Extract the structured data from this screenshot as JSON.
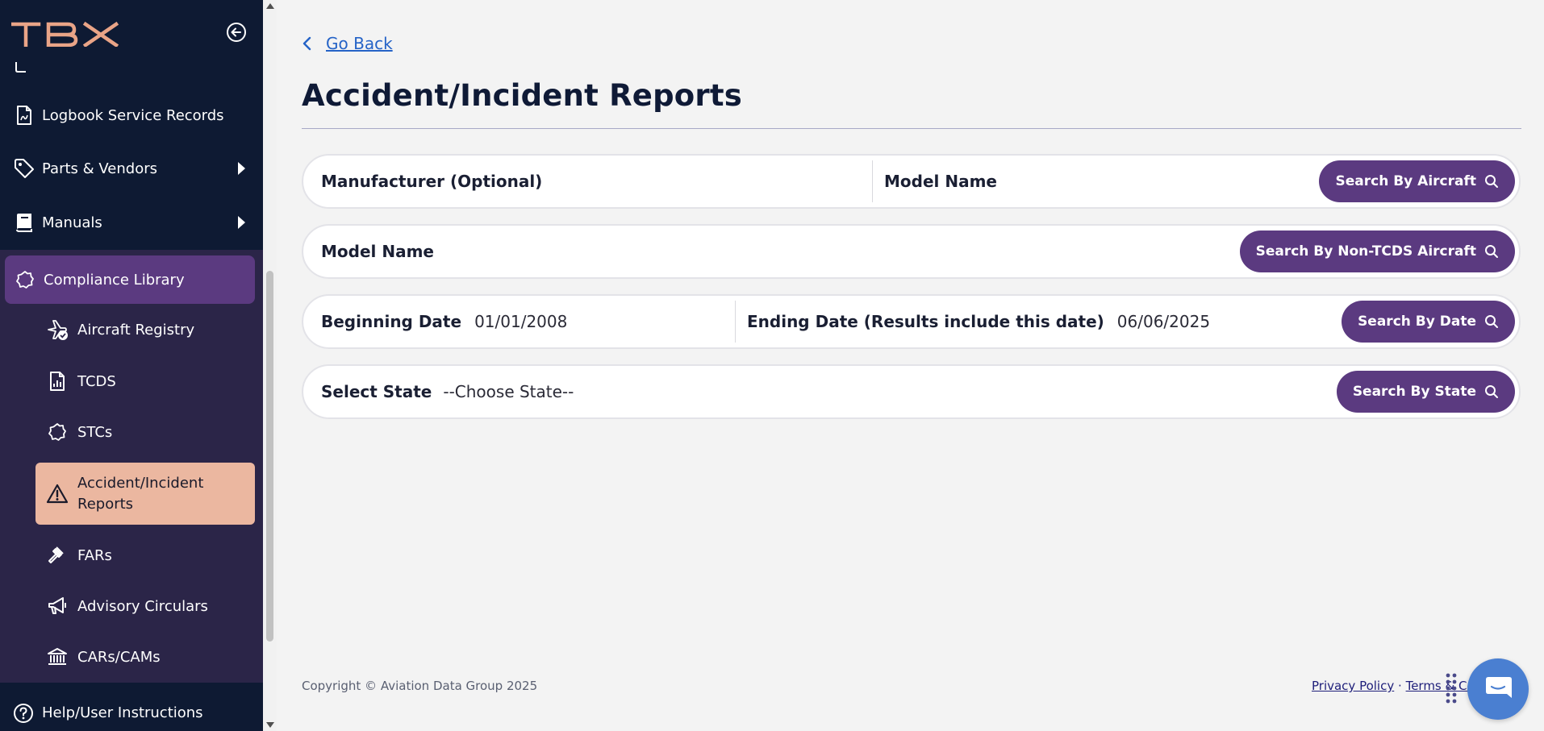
{
  "app": {
    "logo_text": "TBX",
    "collapse_icon": "arrow-left-circle-icon"
  },
  "sidebar": {
    "items": [
      {
        "label": "Logbook Service Records",
        "icon": "document-icon"
      },
      {
        "label": "Parts & Vendors",
        "icon": "tag-icon"
      },
      {
        "label": "Manuals",
        "icon": "book-icon"
      },
      {
        "label": "Compliance Library",
        "icon": "badge-icon",
        "expanded": true
      }
    ],
    "sub_items": [
      {
        "label": "Aircraft Registry",
        "icon": "airplane-check-icon"
      },
      {
        "label": "TCDS",
        "icon": "chart-document-icon"
      },
      {
        "label": "STCs",
        "icon": "badge-icon"
      },
      {
        "label": "Accident/Incident Reports",
        "icon": "warning-icon",
        "active": true
      },
      {
        "label": "FARs",
        "icon": "gavel-icon"
      },
      {
        "label": "Advisory Circulars",
        "icon": "megaphone-icon"
      },
      {
        "label": "CARs/CAMs",
        "icon": "bank-icon"
      }
    ],
    "help": {
      "label": "Help/User Instructions",
      "icon": "question-circle-icon"
    }
  },
  "main": {
    "go_back": "Go Back",
    "title": "Accident/Incident Reports",
    "row1": {
      "manufacturer_label": "Manufacturer (Optional)",
      "model_label": "Model Name",
      "button": "Search By Aircraft"
    },
    "row2": {
      "model_label": "Model Name",
      "button": "Search By Non-TCDS Aircraft"
    },
    "row3": {
      "begin_label": "Beginning Date",
      "begin_value": "01/01/2008",
      "end_label": "Ending Date (Results include this date)",
      "end_value": "06/06/2025",
      "button": "Search By Date"
    },
    "row4": {
      "state_label": "Select State",
      "state_value": "--Choose State--",
      "button": "Search By State"
    }
  },
  "footer": {
    "copyright": "Copyright © Aviation Data Group 2025",
    "privacy": "Privacy Policy",
    "separator": "·",
    "terms": "Terms & Co"
  },
  "colors": {
    "sidebar_bg": "#0e1a33",
    "accent_purple": "#5b3a80",
    "active_item": "#ebb7a0",
    "logo": "#e9a487",
    "link_blue": "#2563c7"
  }
}
